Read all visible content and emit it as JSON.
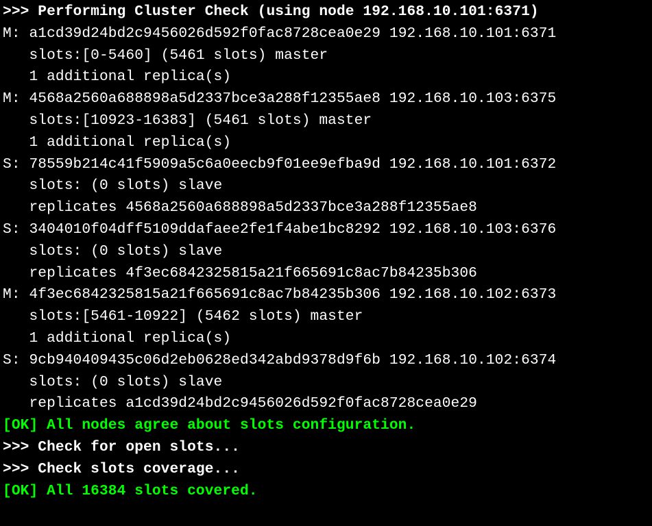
{
  "header": {
    "prefix": ">>> ",
    "text": "Performing Cluster Check (using node 192.168.10.101:6371)"
  },
  "nodes": [
    {
      "role": "M",
      "id": "a1cd39d24bd2c9456026d592f0fac8728cea0e29",
      "address": "192.168.10.101:6371",
      "slots_line": "slots:[0-5460] (5461 slots) master",
      "extra_line": "1 additional replica(s)"
    },
    {
      "role": "M",
      "id": "4568a2560a688898a5d2337bce3a288f12355ae8",
      "address": "192.168.10.103:6375",
      "slots_line": "slots:[10923-16383] (5461 slots) master",
      "extra_line": "1 additional replica(s)"
    },
    {
      "role": "S",
      "id": "78559b214c41f5909a5c6a0eecb9f01ee9efba9d",
      "address": "192.168.10.101:6372",
      "slots_line": "slots: (0 slots) slave",
      "extra_line": "replicates 4568a2560a688898a5d2337bce3a288f12355ae8"
    },
    {
      "role": "S",
      "id": "3404010f04dff5109ddafaee2fe1f4abe1bc8292",
      "address": "192.168.10.103:6376",
      "slots_line": "slots: (0 slots) slave",
      "extra_line": "replicates 4f3ec6842325815a21f665691c8ac7b84235b306"
    },
    {
      "role": "M",
      "id": "4f3ec6842325815a21f665691c8ac7b84235b306",
      "address": "192.168.10.102:6373",
      "slots_line": "slots:[5461-10922] (5462 slots) master",
      "extra_line": "1 additional replica(s)"
    },
    {
      "role": "S",
      "id": "9cb940409435c06d2eb0628ed342abd9378d9f6b",
      "address": "192.168.10.102:6374",
      "slots_line": "slots: (0 slots) slave",
      "extra_line": "replicates a1cd39d24bd2c9456026d592f0fac8728cea0e29"
    }
  ],
  "status": {
    "ok1": "[OK] All nodes agree about slots configuration.",
    "check_open_prefix": ">>> ",
    "check_open": "Check for open slots...",
    "check_coverage_prefix": ">>> ",
    "check_coverage": "Check slots coverage...",
    "ok2": "[OK] All 16384 slots covered."
  }
}
